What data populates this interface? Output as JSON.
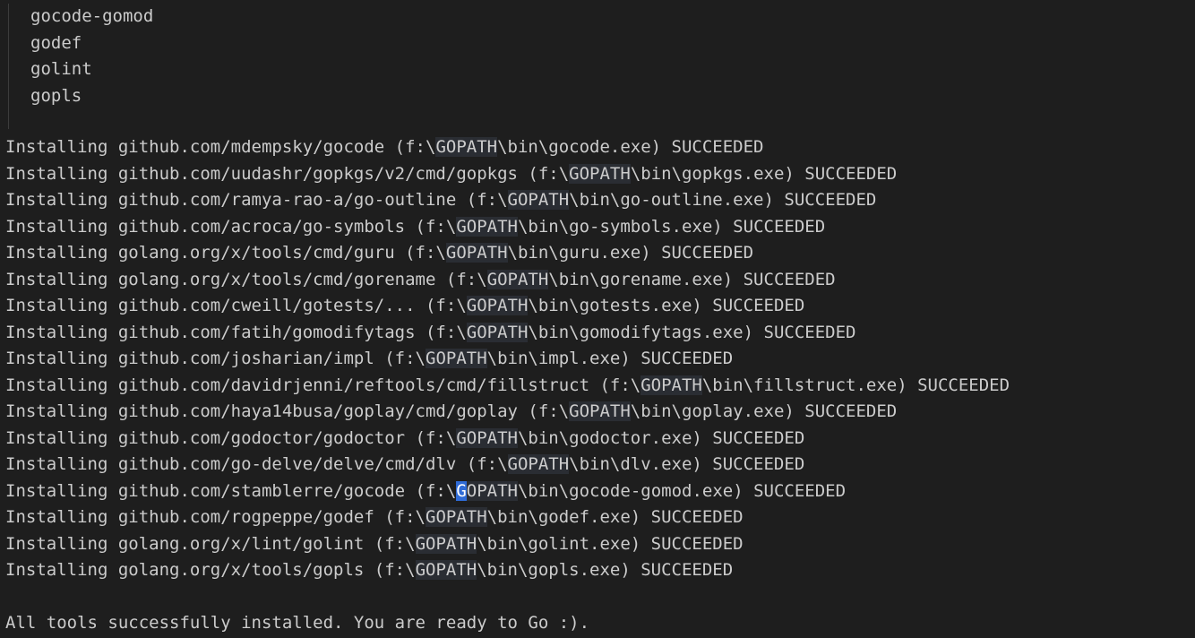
{
  "tool_list": [
    "gocode-gomod",
    "godef",
    "golint",
    "gopls"
  ],
  "install_lines": [
    {
      "prefix": "Installing github.com/mdempsky/gocode (f:\\",
      "var": "GOPATH",
      "suffix": "\\bin\\gocode.exe) SUCCEEDED"
    },
    {
      "prefix": "Installing github.com/uudashr/gopkgs/v2/cmd/gopkgs (f:\\",
      "var": "GOPATH",
      "suffix": "\\bin\\gopkgs.exe) SUCCEEDED"
    },
    {
      "prefix": "Installing github.com/ramya-rao-a/go-outline (f:\\",
      "var": "GOPATH",
      "suffix": "\\bin\\go-outline.exe) SUCCEEDED"
    },
    {
      "prefix": "Installing github.com/acroca/go-symbols (f:\\",
      "var": "GOPATH",
      "suffix": "\\bin\\go-symbols.exe) SUCCEEDED"
    },
    {
      "prefix": "Installing golang.org/x/tools/cmd/guru (f:\\",
      "var": "GOPATH",
      "suffix": "\\bin\\guru.exe) SUCCEEDED"
    },
    {
      "prefix": "Installing golang.org/x/tools/cmd/gorename (f:\\",
      "var": "GOPATH",
      "suffix": "\\bin\\gorename.exe) SUCCEEDED"
    },
    {
      "prefix": "Installing github.com/cweill/gotests/... (f:\\",
      "var": "GOPATH",
      "suffix": "\\bin\\gotests.exe) SUCCEEDED"
    },
    {
      "prefix": "Installing github.com/fatih/gomodifytags (f:\\",
      "var": "GOPATH",
      "suffix": "\\bin\\gomodifytags.exe) SUCCEEDED"
    },
    {
      "prefix": "Installing github.com/josharian/impl (f:\\",
      "var": "GOPATH",
      "suffix": "\\bin\\impl.exe) SUCCEEDED"
    },
    {
      "prefix": "Installing github.com/davidrjenni/reftools/cmd/fillstruct (f:\\",
      "var": "GOPATH",
      "suffix": "\\bin\\fillstruct.exe) SUCCEEDED"
    },
    {
      "prefix": "Installing github.com/haya14busa/goplay/cmd/goplay (f:\\",
      "var": "GOPATH",
      "suffix": "\\bin\\goplay.exe) SUCCEEDED"
    },
    {
      "prefix": "Installing github.com/godoctor/godoctor (f:\\",
      "var": "GOPATH",
      "suffix": "\\bin\\godoctor.exe) SUCCEEDED"
    },
    {
      "prefix": "Installing github.com/go-delve/delve/cmd/dlv (f:\\",
      "var": "GOPATH",
      "suffix": "\\bin\\dlv.exe) SUCCEEDED"
    },
    {
      "prefix": "Installing github.com/stamblerre/gocode (f:\\",
      "var": "GOPATH",
      "suffix": "\\bin\\gocode-gomod.exe) SUCCEEDED",
      "cursor": true
    },
    {
      "prefix": "Installing github.com/rogpeppe/godef (f:\\",
      "var": "GOPATH",
      "suffix": "\\bin\\godef.exe) SUCCEEDED"
    },
    {
      "prefix": "Installing golang.org/x/lint/golint (f:\\",
      "var": "GOPATH",
      "suffix": "\\bin\\golint.exe) SUCCEEDED"
    },
    {
      "prefix": "Installing golang.org/x/tools/gopls (f:\\",
      "var": "GOPATH",
      "suffix": "\\bin\\gopls.exe) SUCCEEDED"
    }
  ],
  "final_message": "All tools successfully installed. You are ready to Go :).",
  "colors": {
    "background": "#1e1e1e",
    "text": "#cccccc",
    "highlight": "#2a2d33",
    "cursor": "#2f6bd6"
  }
}
